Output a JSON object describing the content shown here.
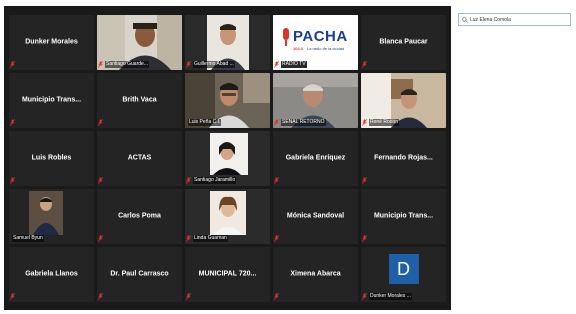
{
  "search": {
    "value": "Luz Elena Comola",
    "icon": "search-icon"
  },
  "mic_color": "#e0322d",
  "tiles": [
    {
      "name": "Dunker Morales"
    },
    {
      "label": "Santiago Guarde..."
    },
    {
      "label": "Guillermo Abad ..."
    },
    {
      "label": "RADIO TV",
      "logo_text": "PACHA",
      "logo_sub": "103.3",
      "logo_tag": "La radio de la ciudad"
    },
    {
      "name": "Blanca Paucar"
    },
    {
      "name": "Municipio  Trans..."
    },
    {
      "name": "Brith Vaca"
    },
    {
      "label": "Luis Peña C.I."
    },
    {
      "label": "SEÑAL RETORNO"
    },
    {
      "label": "René Rodón"
    },
    {
      "name": "Luis Robles"
    },
    {
      "name": "ACTAS"
    },
    {
      "label": "Santiago Jaramillo"
    },
    {
      "name": "Gabriela Enríquez"
    },
    {
      "name": "Fernando  Rojas..."
    },
    {
      "label": "Samuel Byun"
    },
    {
      "name": "Carlos Poma"
    },
    {
      "label": "Linda Guaman"
    },
    {
      "name": "Mónica Sandoval"
    },
    {
      "name": "Municipio  Trans..."
    },
    {
      "name": "Gabriela Llanos"
    },
    {
      "name": "Dr. Paul Carrasco"
    },
    {
      "name": "MUNICIPAL  720..."
    },
    {
      "name": "Ximena Abarca"
    },
    {
      "label": "Dunker Morales ...",
      "avatar_letter": "D"
    }
  ]
}
